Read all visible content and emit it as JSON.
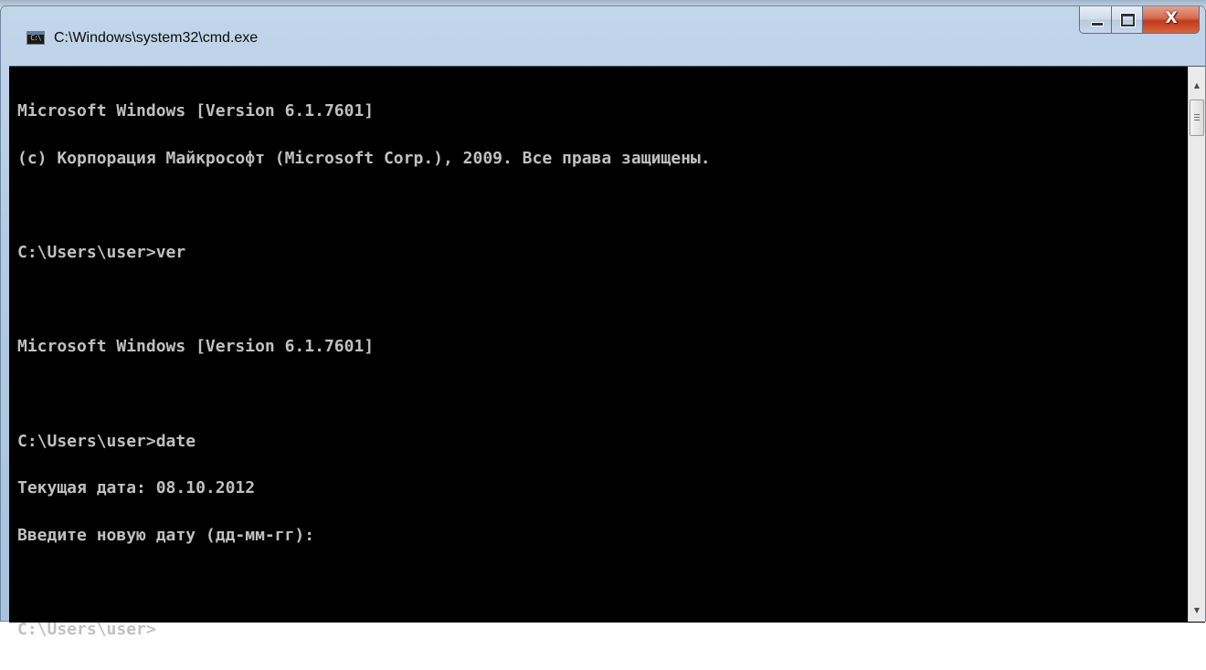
{
  "window": {
    "title": "C:\\Windows\\system32\\cmd.exe",
    "icon": "cmd-icon",
    "icon_text": "C:\\"
  },
  "controls": {
    "minimize_icon": "minimize-icon",
    "maximize_icon": "maximize-icon",
    "close_icon": "close-icon",
    "close_glyph": "X",
    "close_color": "#c0391b"
  },
  "console": {
    "background": "#000000",
    "text_color": "#c0c0c0",
    "lines": [
      "Microsoft Windows [Version 6.1.7601]",
      "(c) Корпорация Майкрософт (Microsoft Corp.), 2009. Все права защищены.",
      "",
      "C:\\Users\\user>ver",
      "",
      "Microsoft Windows [Version 6.1.7601]",
      "",
      "C:\\Users\\user>date",
      "Текущая дата: 08.10.2012",
      "Введите новую дату (дд-мм-гг):",
      "",
      "C:\\Users\\user>"
    ]
  },
  "scrollbar": {
    "up_arrow": "▲",
    "down_arrow": "▼"
  }
}
